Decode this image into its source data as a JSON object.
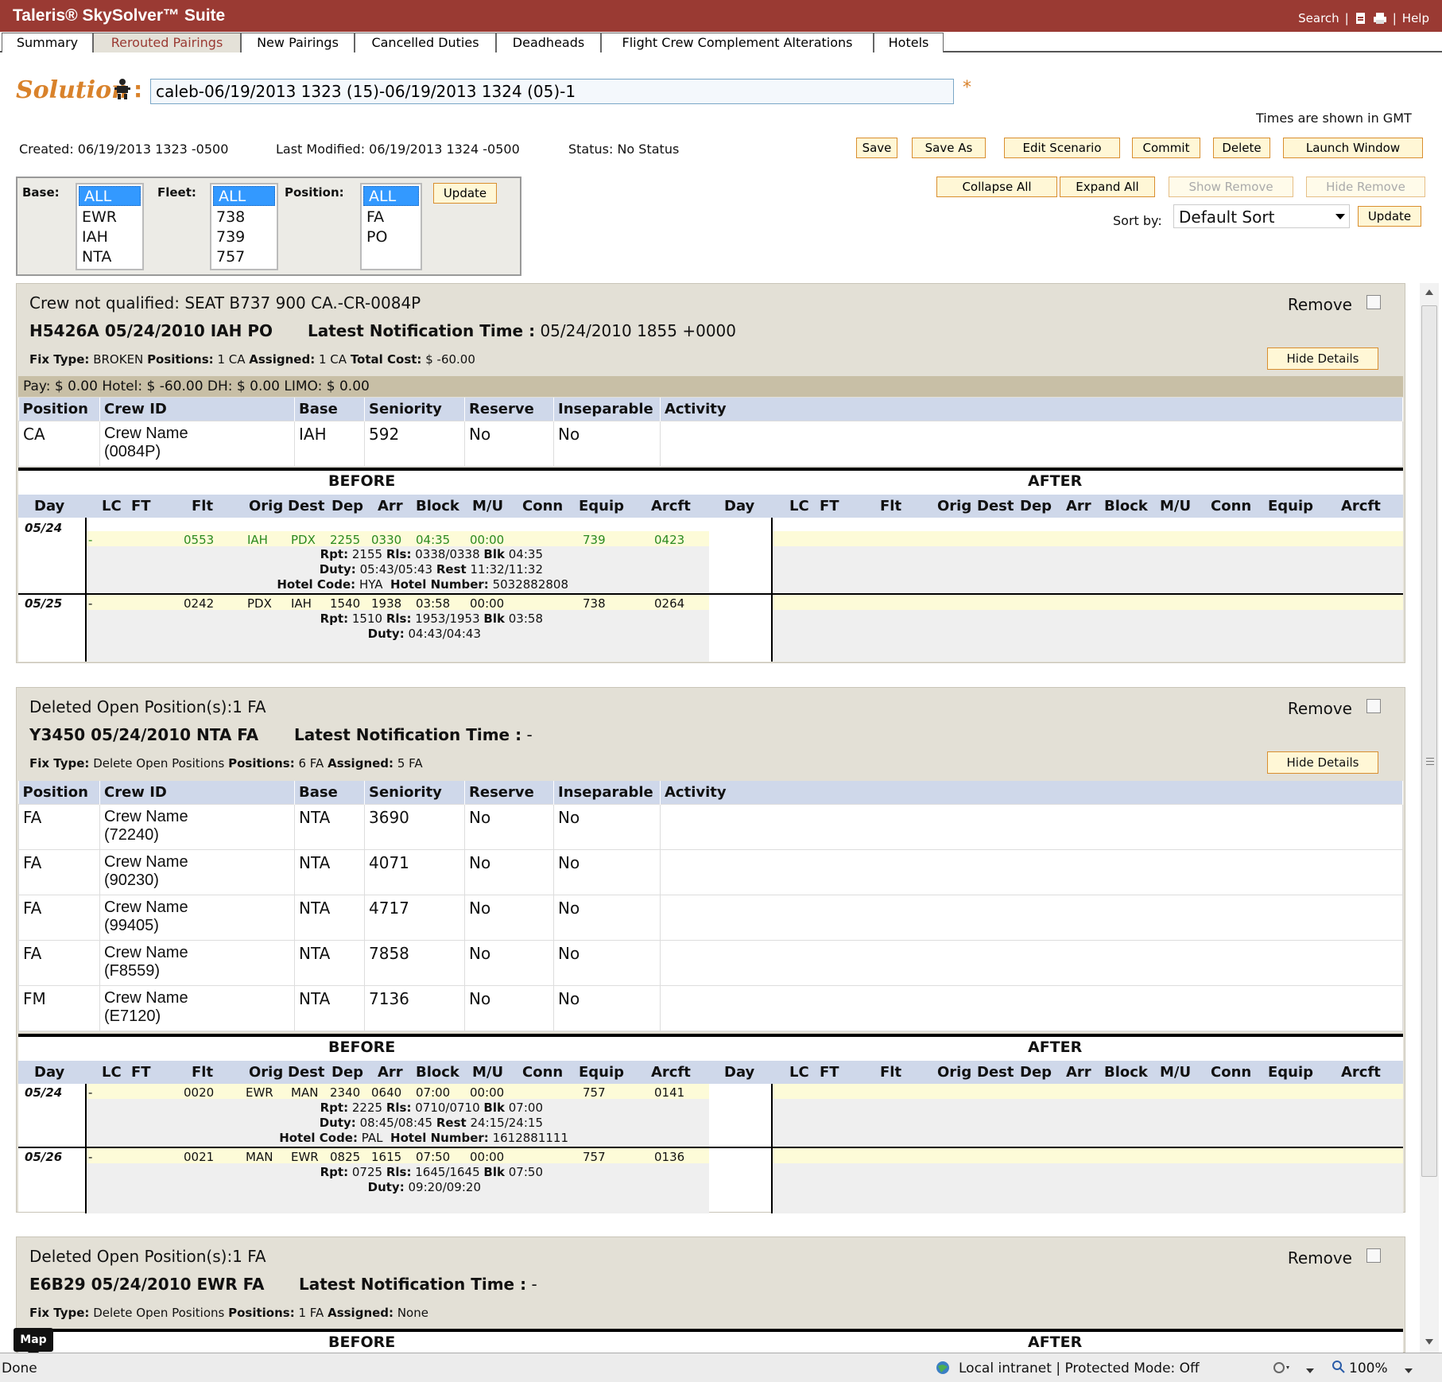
{
  "app": {
    "title": "Taleris® SkySolver™ Suite",
    "links": {
      "search": "Search",
      "sep1": "|",
      "sep2": "|",
      "help": "Help"
    }
  },
  "tabs": [
    "Summary",
    "Rerouted Pairings",
    "New Pairings",
    "Cancelled Duties",
    "Deadheads",
    "Flight Crew Complement Alterations",
    "Hotels"
  ],
  "solution": {
    "label": "Solution",
    "colon": ":",
    "value": "caleb-06/19/2013 1323 (15)-06/19/2013 1324 (05)-1",
    "star": "*"
  },
  "times_note": "Times are shown in GMT",
  "meta": {
    "created": "Created: 06/19/2013 1323 -0500",
    "modified": "Last Modified: 06/19/2013 1324 -0500",
    "status": "Status: No Status"
  },
  "buttons": {
    "save": "Save",
    "save_as": "Save As",
    "edit_scenario": "Edit Scenario",
    "commit": "Commit",
    "delete": "Delete",
    "launch_window": "Launch Window",
    "collapse_all": "Collapse All",
    "expand_all": "Expand All",
    "show_remove": "Show Remove",
    "hide_remove": "Hide Remove",
    "update": "Update",
    "update2": "Update"
  },
  "filters": {
    "base_label": "Base:",
    "fleet_label": "Fleet:",
    "position_label": "Position:",
    "base": [
      "ALL",
      "EWR",
      "IAH",
      "NTA"
    ],
    "fleet": [
      "ALL",
      "738",
      "739",
      "757"
    ],
    "position": [
      "ALL",
      "FA",
      "PO"
    ]
  },
  "sort": {
    "label": "Sort by:",
    "value": "Default Sort"
  },
  "common": {
    "remove": "Remove",
    "hide_details": "Hide Details",
    "before": "BEFORE",
    "after": "AFTER",
    "lnt": "Latest Notification Time :",
    "crew_cols": [
      "Position",
      "Crew ID",
      "Base",
      "Seniority",
      "Reserve",
      "Inseparable",
      "Activity"
    ],
    "flight_cols": [
      "Day",
      "LC",
      "FT",
      "Flt",
      "Orig",
      "Dest",
      "Dep",
      "Arr",
      "Block",
      "M/U",
      "Conn",
      "Equip",
      "Arcft"
    ],
    "k_fix": "Fix Type:",
    "k_pos": "Positions:",
    "k_asg": "Assigned:",
    "k_cost": "Total Cost:",
    "k_rpt": "Rpt:",
    "k_rls": "Rls:",
    "k_blk": "Blk",
    "k_duty": "Duty:",
    "k_rest": "Rest",
    "k_hc": "Hotel Code:",
    "k_hn": "Hotel Number:"
  },
  "p1": {
    "head": "Crew not qualified: SEAT B737 900 CA.-CR-0084P",
    "code": "H5426A 05/24/2010 IAH PO",
    "lnt_value": "05/24/2010 1855 +0000",
    "fix": "BROKEN",
    "positions": "1 CA",
    "assigned": "1 CA",
    "cost": "$ -60.00",
    "pay": "Pay: $ 0.00 Hotel: $ -60.00 DH: $ 0.00 LIMO: $ 0.00",
    "crew": [
      [
        "CA",
        "Crew Name",
        "(0084P)",
        "IAH",
        "592",
        "No",
        "No",
        ""
      ]
    ],
    "days": [
      {
        "day": "05/24",
        "lc": "-",
        "flt": "0553",
        "orig": "IAH",
        "dest": "PDX",
        "dep": "2255",
        "arr": "0330",
        "blk": "04:35",
        "mu": "00:00",
        "conn": "",
        "equip": "739",
        "arcft": "0423",
        "rpt": "2155",
        "rls": "0338/0338",
        "blkd": "04:35",
        "duty": "05:43/05:43",
        "rest": "11:32/11:32",
        "hc": "HYA",
        "hn": "5032882808"
      },
      {
        "day": "05/25",
        "lc": "-",
        "flt": "0242",
        "orig": "PDX",
        "dest": "IAH",
        "dep": "1540",
        "arr": "1938",
        "blk": "03:58",
        "mu": "00:00",
        "conn": "",
        "equip": "738",
        "arcft": "0264",
        "rpt": "1510",
        "rls": "1953/1953",
        "blkd": "03:58",
        "duty": "04:43/04:43"
      }
    ]
  },
  "p2": {
    "head": "Deleted Open Position(s):1 FA",
    "code": "Y3450 05/24/2010 NTA FA",
    "lnt_value": "-",
    "fix": "Delete Open Positions",
    "positions": "6 FA",
    "assigned": "5 FA",
    "crew": [
      [
        "FA",
        "Crew Name",
        "(72240)",
        "NTA",
        "3690",
        "No",
        "No",
        ""
      ],
      [
        "FA",
        "Crew Name",
        "(90230)",
        "NTA",
        "4071",
        "No",
        "No",
        ""
      ],
      [
        "FA",
        "Crew Name",
        "(99405)",
        "NTA",
        "4717",
        "No",
        "No",
        ""
      ],
      [
        "FA",
        "Crew Name",
        "(F8559)",
        "NTA",
        "7858",
        "No",
        "No",
        ""
      ],
      [
        "FM",
        "Crew Name",
        "(E7120)",
        "NTA",
        "7136",
        "No",
        "No",
        ""
      ]
    ],
    "days": [
      {
        "day": "05/24",
        "lc": "-",
        "flt": "0020",
        "orig": "EWR",
        "dest": "MAN",
        "dep": "2340",
        "arr": "0640",
        "blk": "07:00",
        "mu": "00:00",
        "conn": "",
        "equip": "757",
        "arcft": "0141",
        "rpt": "2225",
        "rls": "0710/0710",
        "blkd": "07:00",
        "duty": "08:45/08:45",
        "rest": "24:15/24:15",
        "hc": "PAL",
        "hn": "1612881111"
      },
      {
        "day": "05/26",
        "lc": "-",
        "flt": "0021",
        "orig": "MAN",
        "dest": "EWR",
        "dep": "0825",
        "arr": "1615",
        "blk": "07:50",
        "mu": "00:00",
        "conn": "",
        "equip": "757",
        "arcft": "0136",
        "rpt": "0725",
        "rls": "1645/1645",
        "blkd": "07:50",
        "duty": "09:20/09:20"
      }
    ]
  },
  "p3": {
    "head": "Deleted Open Position(s):1 FA",
    "code": "E6B29 05/24/2010 EWR FA",
    "lnt_value": "-",
    "fix": "Delete Open Positions",
    "positions": "1 FA",
    "assigned": "None"
  },
  "statusbar": {
    "left": "Done",
    "zone": "Local intranet | Protected Mode: Off",
    "zoom": "100%",
    "map": "Map"
  },
  "colors": {
    "title_bar": "#9a3a33",
    "solution": "#d9822b",
    "panel": "#e3e0d6",
    "col_header": "#cfd8ea"
  }
}
